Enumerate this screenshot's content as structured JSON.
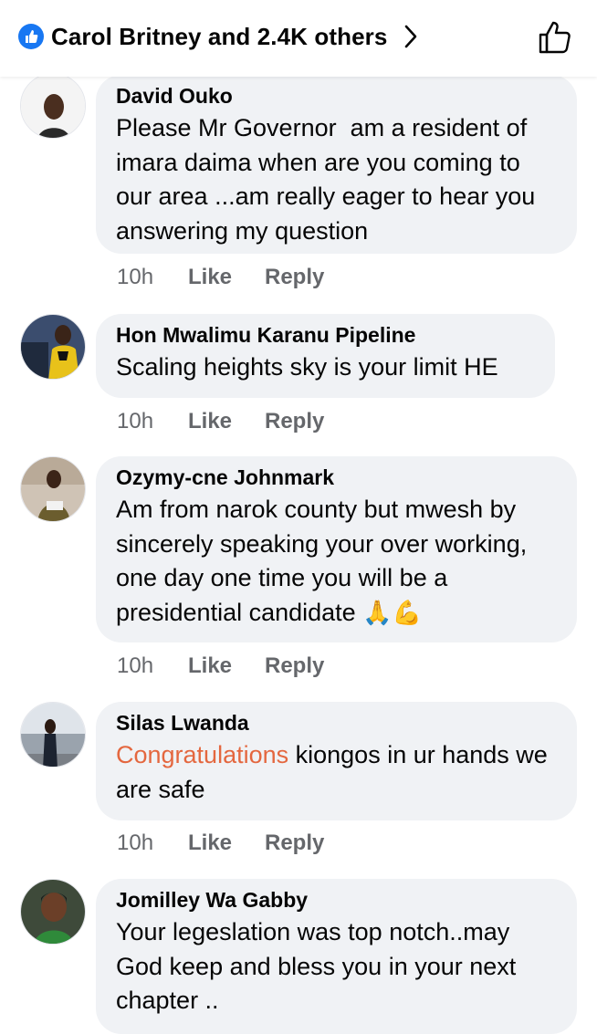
{
  "header": {
    "reactions_text": "Carol Britney and 2.4K others",
    "like_badge_icon": "like-thumb-icon",
    "chevron_icon": "chevron-right-icon",
    "like_button_icon": "thumbs-up-outline-icon",
    "accent": "#1877f2"
  },
  "comments": [
    {
      "author": "David Ouko",
      "text": "Please Mr Governor  am a resident of imara daima when are you coming to our area ...am really eager to hear you answering my question",
      "time": "10h",
      "like": "Like",
      "reply": "Reply"
    },
    {
      "author": "Hon Mwalimu Karanu Pipeline",
      "text": "Scaling heights sky is your limit HE",
      "time": "10h",
      "like": "Like",
      "reply": "Reply"
    },
    {
      "author": "Ozymy-cne Johnmark",
      "text": "Am from narok county but mwesh by sincerely speaking your over working, one day one time you will be a presidential candidate",
      "emojis": "🙏💪",
      "time": "10h",
      "like": "Like",
      "reply": "Reply"
    },
    {
      "author": "Silas Lwanda",
      "highlight": "Congratulations",
      "text": " kiongos in ur hands we are safe",
      "highlight_color": "#e4673f",
      "time": "10h",
      "like": "Like",
      "reply": "Reply"
    },
    {
      "author": "Jomilley Wa Gabby",
      "text": "Your legeslation was top notch..may God keep and bless you in your next chapter ..",
      "time": "",
      "like": "",
      "reply": ""
    }
  ]
}
